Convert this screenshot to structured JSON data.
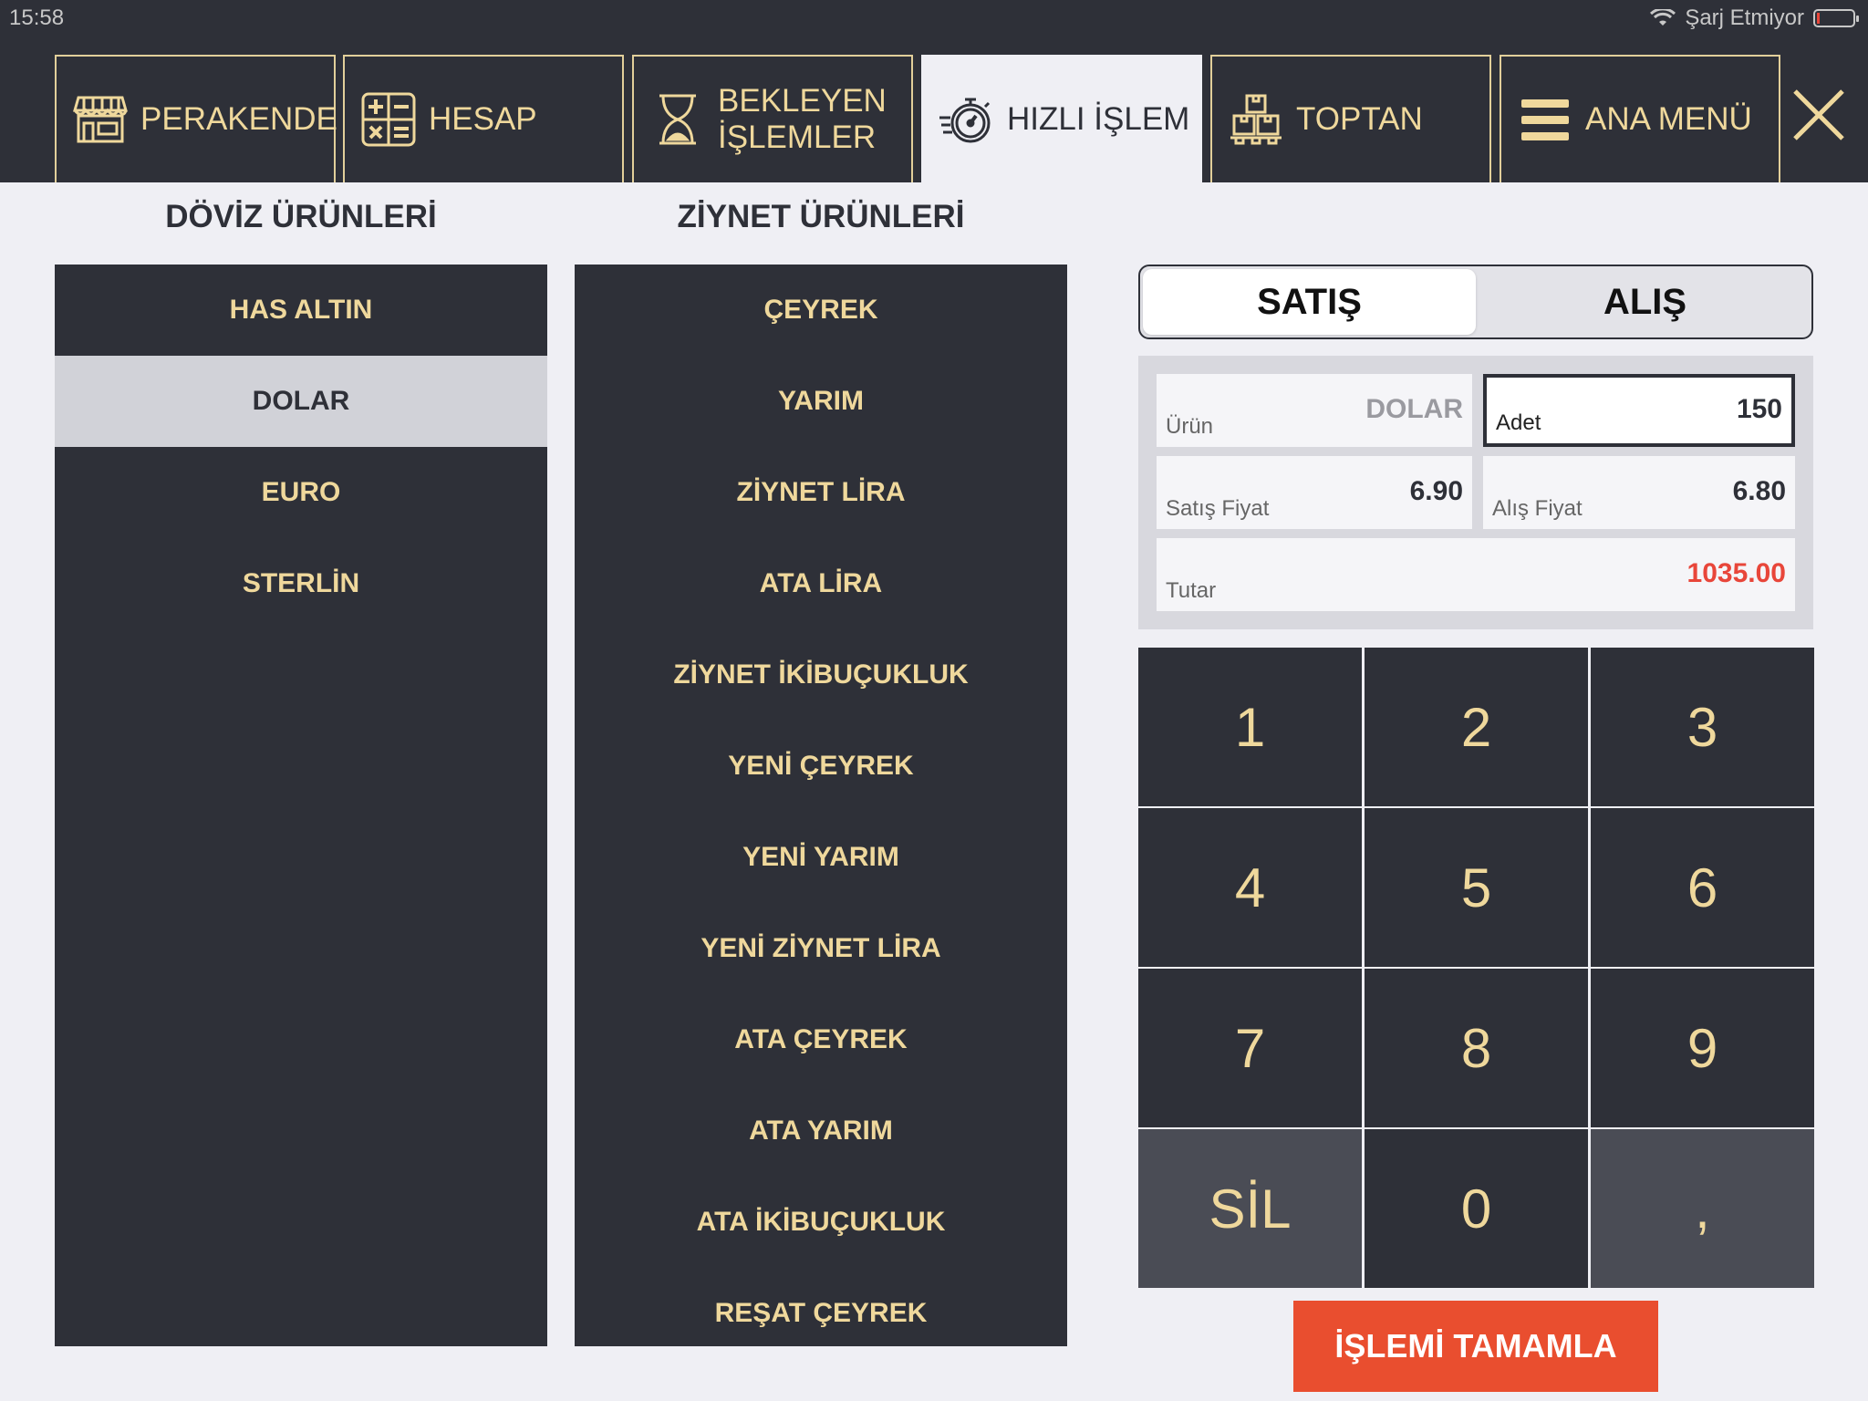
{
  "status": {
    "time": "15:58",
    "charging": "Şarj Etmiyor"
  },
  "tabs": [
    {
      "label": "PERAKENDE",
      "icon": "store-icon"
    },
    {
      "label": "HESAP",
      "icon": "calculator-icon"
    },
    {
      "label": "BEKLEYEN\nİŞLEMLER",
      "icon": "hourglass-icon"
    },
    {
      "label": "HIZLI İŞLEM",
      "icon": "stopwatch-icon",
      "active": true
    },
    {
      "label": "TOPTAN",
      "icon": "boxes-icon"
    },
    {
      "label": "ANA MENÜ",
      "icon": "menu-icon"
    }
  ],
  "doviz": {
    "heading": "DÖVİZ ÜRÜNLERİ",
    "items": [
      "HAS ALTIN",
      "DOLAR",
      "EURO",
      "STERLİN"
    ],
    "selected": "DOLAR"
  },
  "ziynet": {
    "heading": "ZİYNET ÜRÜNLERİ",
    "items": [
      "ÇEYREK",
      "YARIM",
      "ZİYNET LİRA",
      "ATA LİRA",
      "ZİYNET İKİBUÇUKLUK",
      "YENİ ÇEYREK",
      "YENİ YARIM",
      "YENİ ZİYNET LİRA",
      "ATA ÇEYREK",
      "ATA YARIM",
      "ATA İKİBUÇUKLUK",
      "REŞAT ÇEYREK"
    ]
  },
  "mode": {
    "sell": "SATIŞ",
    "buy": "ALIŞ",
    "selected": "SATIŞ"
  },
  "form": {
    "urun_label": "Ürün",
    "urun_value": "DOLAR",
    "adet_label": "Adet",
    "adet_value": "150",
    "satis_label": "Satış Fiyat",
    "satis_value": "6.90",
    "alis_label": "Alış Fiyat",
    "alis_value": "6.80",
    "tutar_label": "Tutar",
    "tutar_value": "1035.00"
  },
  "keypad": [
    "1",
    "2",
    "3",
    "4",
    "5",
    "6",
    "7",
    "8",
    "9",
    "SİL",
    "0",
    ","
  ],
  "complete_label": "İŞLEMİ TAMAMLA",
  "colors": {
    "dark": "#2e3038",
    "gold": "#efd89c",
    "accent": "#e94e2f",
    "total": "#e8463a"
  }
}
